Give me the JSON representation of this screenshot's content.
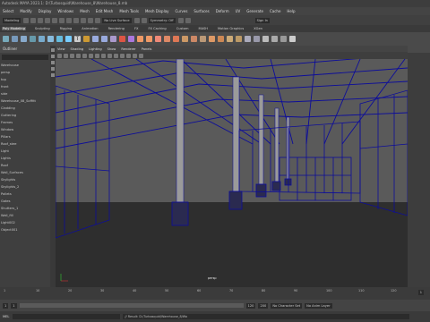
{
  "app": {
    "title": "Autodesk MAYA 2023.1: D:\\Turbosquid\\Warehouse_8\\Warehouse_8.mb"
  },
  "menubar": {
    "items": [
      "Select",
      "Modify",
      "Display",
      "Windows",
      "Mesh",
      "Edit Mesh",
      "Mesh Tools",
      "Mesh Display",
      "Curves",
      "Surfaces",
      "Deform",
      "UV",
      "Generate",
      "Cache",
      "Help"
    ]
  },
  "statusline": {
    "mode": "Modeling",
    "live_surface": "No Live Surface",
    "symmetry": "Symmetry: Off",
    "signin": "Sign In"
  },
  "shelf": {
    "tabs": [
      "Poly Modeling",
      "Sculpting",
      "Rigging",
      "Animation",
      "Rendering",
      "FX",
      "FX Caching",
      "Custom",
      "MASH",
      "Motion Graphics",
      "XGen"
    ],
    "active": 0
  },
  "outliner": {
    "title": "Outliner",
    "items": [
      "Warehouse",
      "persp",
      "top",
      "front",
      "side",
      "Warehouse_08_Soffitt",
      "Cladding",
      "Guttering",
      "Frames",
      "Window",
      "Pillars",
      "Roof_stee",
      "Light",
      "Lights",
      "Roof",
      "Wall_Surfaces",
      "Skylights",
      "Skylights_2",
      "Pallets",
      "Gates",
      "Shutters_1",
      "Wall_fill",
      "Light002",
      "Object001"
    ]
  },
  "viewport": {
    "menu": [
      "View",
      "Shading",
      "Lighting",
      "Show",
      "Renderer",
      "Panels"
    ],
    "camera_label": "persp"
  },
  "timeslider": {
    "ticks": [
      "1",
      "10",
      "20",
      "30",
      "40",
      "50",
      "60",
      "70",
      "80",
      "90",
      "100",
      "110",
      "120"
    ],
    "current_frame": "1"
  },
  "rangebar": {
    "start": "1",
    "end": "120",
    "range_end": "200",
    "char_set": "No Character Set",
    "anim_layer": "No Anim Layer"
  },
  "cmdline": {
    "lang": "MEL",
    "result": "// Result: D:/Turbosquid/Warehouse_8/Wa"
  },
  "colors": {
    "wire": "#0d0d9a",
    "viewport_bg": "#5a5a5a",
    "floor": "#2e2e2e"
  }
}
